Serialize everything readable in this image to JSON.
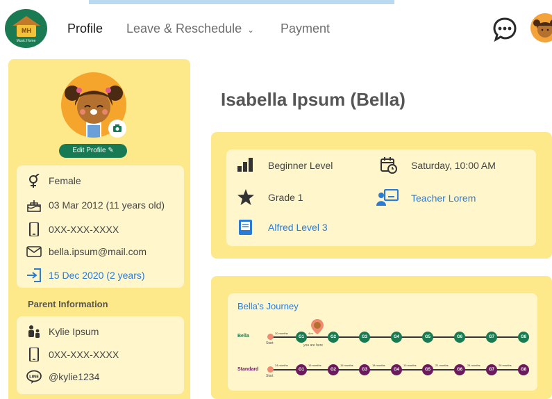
{
  "app": {
    "logo_text": "MH",
    "logo_subtext": "Music Home"
  },
  "nav": {
    "profile": "Profile",
    "leave": "Leave & Reschedule",
    "payment": "Payment"
  },
  "profile": {
    "edit_label": "Edit Profile",
    "gender": "Female",
    "birthday": "03 Mar 2012 (11 years old)",
    "phone": "0XX-XXX-XXXX",
    "email": "bella.ipsum@mail.com",
    "joined": "15 Dec 2020 (2 years)",
    "name": "Isabella Ipsum (Bella)"
  },
  "parent": {
    "title": "Parent Information",
    "name": "Kylie Ipsum",
    "phone": "0XX-XXX-XXXX",
    "line": "@kylie1234"
  },
  "details": {
    "level": "Beginner Level",
    "schedule": "Saturday, 10:00 AM",
    "grade": "Grade 1",
    "teacher": "Teacher Lorem",
    "book": "Alfred Level 3"
  },
  "journey": {
    "title": "Bella's Journey",
    "bella_label": "Bella",
    "standard_label": "Standard",
    "start": "Start",
    "you_are_here": "you are here",
    "bella_nodes": [
      "G1",
      "G2",
      "G3",
      "G4",
      "G5",
      "G6",
      "G7",
      "G8"
    ],
    "bella_durations": [
      "20 months",
      "4 m"
    ],
    "standard_nodes": [
      "G1",
      "G2",
      "G3",
      "G4",
      "G5",
      "G6",
      "G7",
      "G8"
    ],
    "standard_durations": [
      "24 months",
      "16 months",
      "15 months",
      "18 months",
      "10 months",
      "21 months",
      "24 months",
      "26 months"
    ]
  },
  "colors": {
    "accent_green": "#187a55",
    "panel_yellow": "#fde98a",
    "card_cream": "#fff6cc",
    "link_blue": "#2a7bd5",
    "standard_purple": "#6c1a5e"
  }
}
